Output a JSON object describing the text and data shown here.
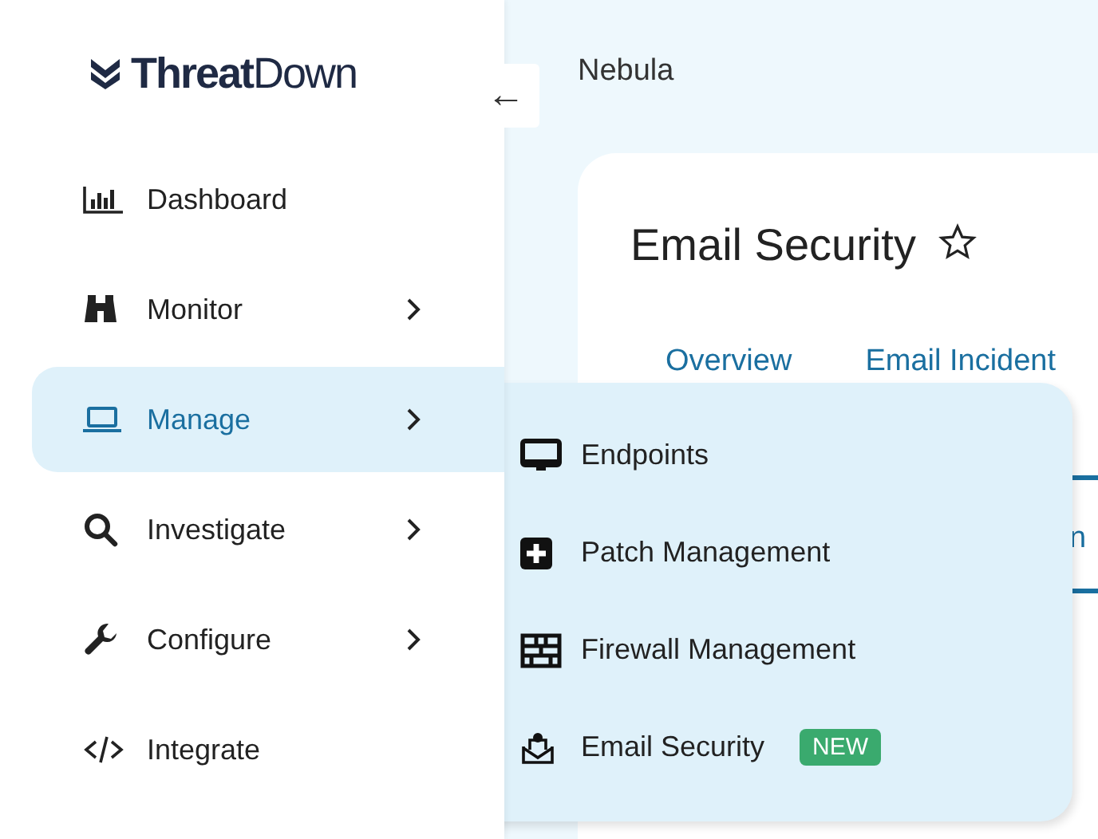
{
  "logo": {
    "text": "**Threat**Down"
  },
  "collapse_button": {
    "glyph": "←"
  },
  "sidebar": {
    "items": [
      {
        "kind": "dashboard",
        "label": "Dashboard",
        "has_submenu": false,
        "selected": false
      },
      {
        "kind": "monitor",
        "label": "Monitor",
        "has_submenu": true,
        "selected": false
      },
      {
        "kind": "manage",
        "label": "Manage",
        "has_submenu": true,
        "selected": true
      },
      {
        "kind": "investigate",
        "label": "Investigate",
        "has_submenu": true,
        "selected": false
      },
      {
        "kind": "configure",
        "label": "Configure",
        "has_submenu": true,
        "selected": false
      },
      {
        "kind": "integrate",
        "label": "Integrate",
        "has_submenu": false,
        "selected": false
      }
    ]
  },
  "breadcrumb": "Nebula",
  "page": {
    "title": "Email Security",
    "favorite": false,
    "tabs": [
      {
        "label": "Overview"
      },
      {
        "label": "Email Incident"
      }
    ],
    "subtab_fragment": "n"
  },
  "submenu": {
    "items": [
      {
        "kind": "endpoints",
        "label": "Endpoints"
      },
      {
        "kind": "patch",
        "label": "Patch Management"
      },
      {
        "kind": "firewall",
        "label": "Firewall Management"
      },
      {
        "kind": "email",
        "label": "Email Security",
        "badge": "NEW"
      }
    ]
  }
}
